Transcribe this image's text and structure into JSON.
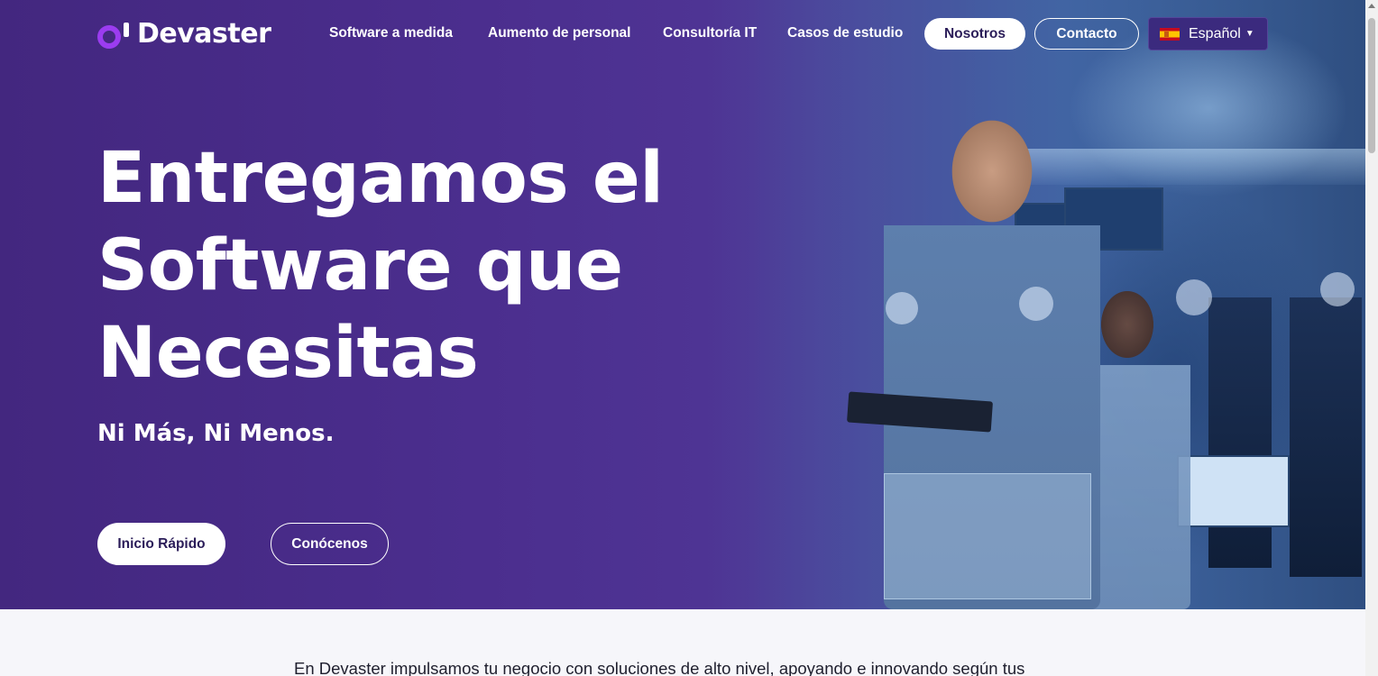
{
  "brand": {
    "name": "Devaster"
  },
  "nav": {
    "links": [
      "Software a medida",
      "Aumento de personal",
      "Consultoría IT",
      "Casos de estudio"
    ],
    "about_label": "Nosotros",
    "contact_label": "Contacto",
    "language": {
      "selected": "Español",
      "flag_icon": "spain-flag-icon"
    }
  },
  "hero": {
    "headline_lines": [
      "Entregamos el",
      "Software que",
      "Necesitas"
    ],
    "subheadline": "Ni Más, Ni Menos.",
    "primary_cta": "Inicio Rápido",
    "secondary_cta": "Conócenos"
  },
  "intro": {
    "text": "En Devaster impulsamos tu negocio con soluciones de alto nivel, apoyando e innovando según tus"
  },
  "colors": {
    "brand_purple": "#9b3cf0",
    "hero_bg": "#4b2e8e",
    "button_text": "#2b1d59"
  }
}
